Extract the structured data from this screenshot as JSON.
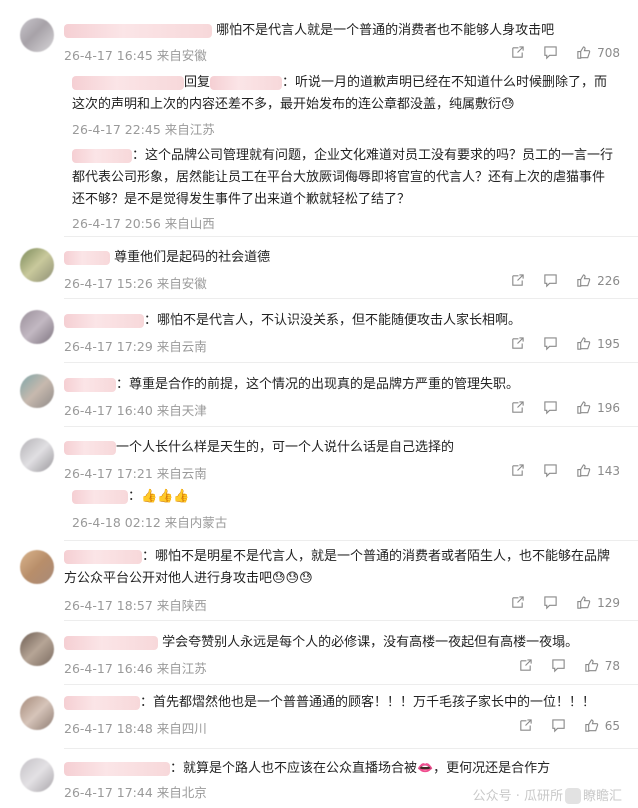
{
  "comments": [
    {
      "text": "哪怕不是代言人就是一个普通的消费者也不能够人身攻击吧",
      "time": "26-4-17 16:45",
      "location": "来自安徽",
      "likes": "708"
    },
    {
      "reply_word": "回复",
      "text": "：听说一月的道歉声明已经在不知道什么时候删除了，而这次的声明和上次的内容还差不多，最开始发布的连公章都没盖，纯属敷衍😓",
      "time": "26-4-17 22:45",
      "location": "来自江苏"
    },
    {
      "text": "：这个品牌公司管理就有问题，企业文化难道对员工没有要求的吗？员工的一言一行都代表公司形象，居然能让员工在平台大放厥词侮辱即将官宣的代言人？还有上次的虐猫事件还不够？是不是觉得发生事件了出来道个歉就轻松了结了？",
      "time": "26-4-17 20:56",
      "location": "来自山西"
    },
    {
      "text": "尊重他们是起码的社会道德",
      "time": "26-4-17 15:26",
      "location": "来自安徽",
      "likes": "226"
    },
    {
      "text": "：哪怕不是代言人，不认识没关系，但不能随便攻击人家长相啊。",
      "time": "26-4-17 17:29",
      "location": "来自云南",
      "likes": "195"
    },
    {
      "text": "：尊重是合作的前提，这个情况的出现真的是品牌方严重的管理失职。",
      "time": "26-4-17 16:40",
      "location": "来自天津",
      "likes": "196"
    },
    {
      "text": "一个人长什么样是天生的，可一个人说什么话是自己选择的",
      "time": "26-4-17 17:21",
      "location": "来自云南",
      "likes": "143"
    },
    {
      "text": "：👍👍👍",
      "time": "26-4-18 02:12",
      "location": "来自内蒙古"
    },
    {
      "text": "：哪怕不是明星不是代言人，就是一个普通的消费者或者陌生人，也不能够在品牌方公众平台公开对他人进行身攻击吧😓😓😓",
      "time": "26-4-17 18:57",
      "location": "来自陕西",
      "likes": "129"
    },
    {
      "text": "学会夸赞别人永远是每个人的必修课，没有高楼一夜起但有高楼一夜塌。",
      "time": "26-4-17 16:46",
      "location": "来自江苏",
      "likes": "78"
    },
    {
      "text": "：首先都熠然他也是一个普普通通的顾客！！！万千毛孩子家长中的一位！！！",
      "time": "26-4-17 18:48",
      "location": "来自四川",
      "likes": "65"
    },
    {
      "text": "：就算是个路人也不应该在公众直播场合被👄，更何况还是合作方",
      "time": "26-4-17 17:44",
      "location": "来自北京"
    }
  ],
  "watermark": {
    "left": "公众号 · 瓜研所",
    "right": "瞭瞻汇"
  },
  "icons": {
    "share": "share-icon",
    "comment": "comment-icon",
    "like": "thumbs-up-icon"
  }
}
